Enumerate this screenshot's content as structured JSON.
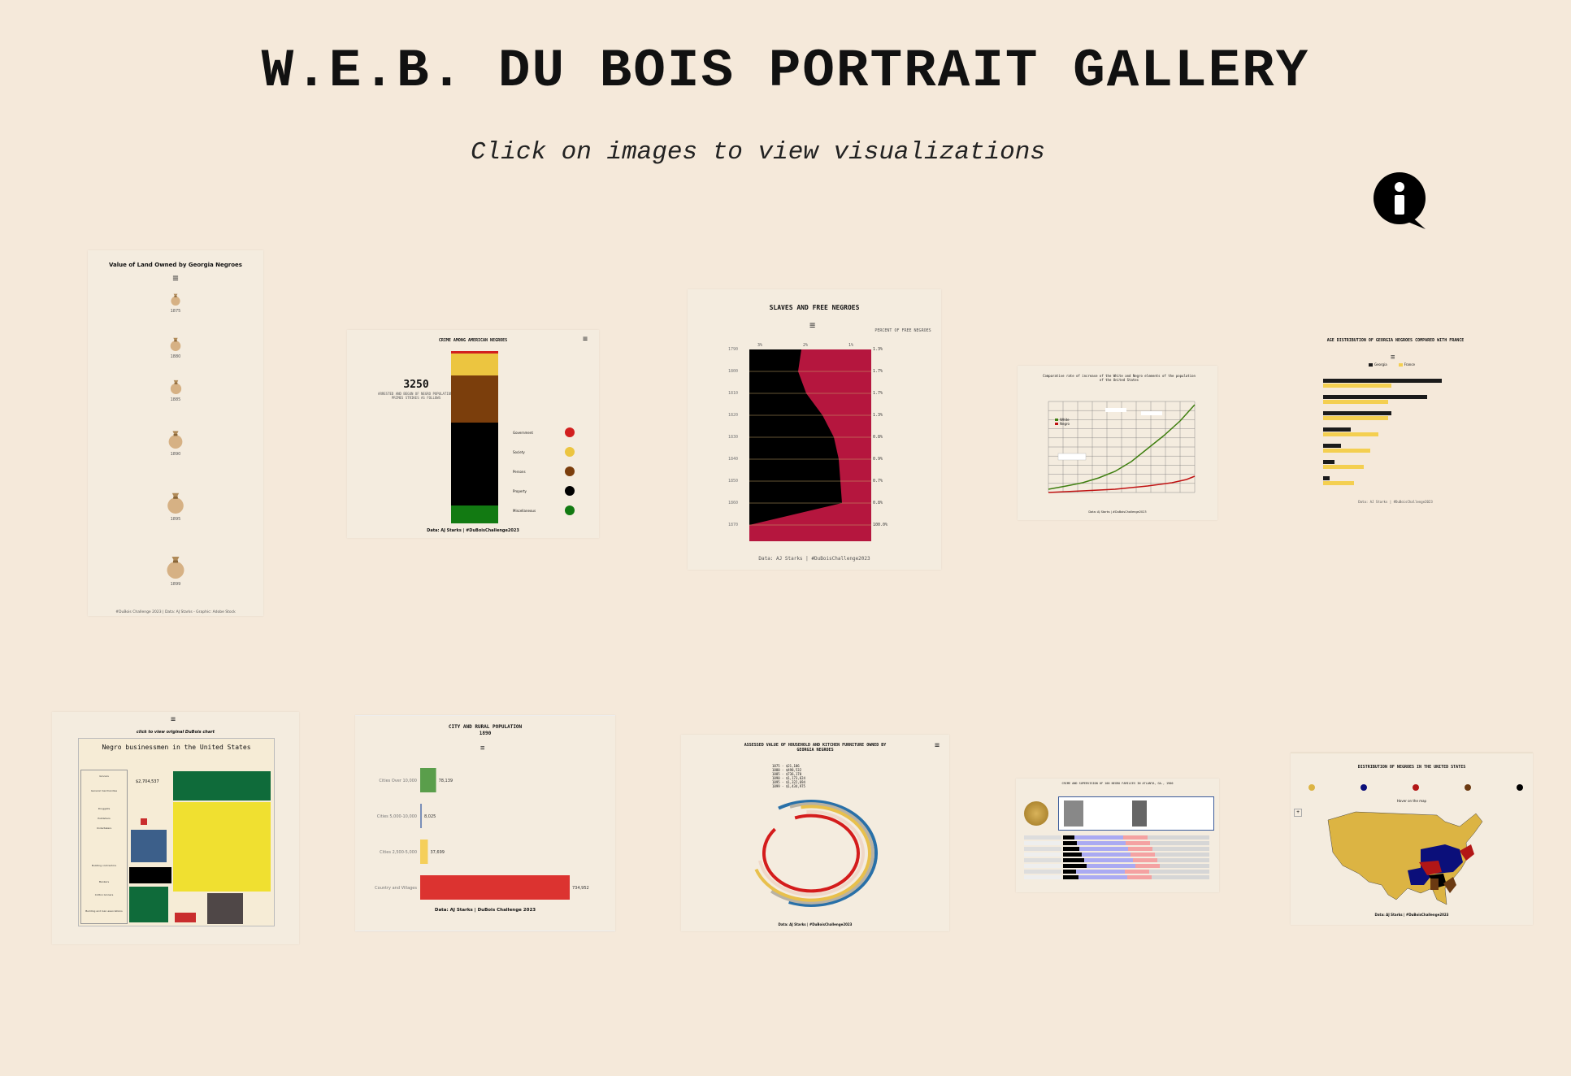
{
  "page": {
    "title": "W.E.B. DU BOIS PORTRAIT GALLERY",
    "subtitle": "Click on images to view visualizations",
    "info_icon": "info-speech-bubble-icon"
  },
  "thumbs": {
    "land": {
      "title": "Value of Land Owned by Georgia Negroes",
      "years": [
        "1875",
        "1880",
        "1885",
        "1890",
        "1895",
        "1899"
      ],
      "footer": "#DuBois Challenge 2023 | Data: AJ Starks - Graphic: Adobe Stock"
    },
    "crime": {
      "title": "CRIME AMONG AMERICAN NEGROES",
      "number": "3250",
      "desc": "ARRESTED AND BEGUN OF NEGRO POPULATION, PRIMES STRIKES AS FOLLOWS",
      "legend": [
        "Government",
        "Society",
        "Persons",
        "Property",
        "Miscellaneous"
      ],
      "footer": "Data: AJ Starks | #DuBoisChallenge2023"
    },
    "slaves": {
      "title": "SLAVES AND FREE NEGROES",
      "right_header": "PERCENT OF FREE NEGROES",
      "top_ticks": [
        "3%",
        "2%",
        "1%"
      ],
      "years": [
        "1790",
        "1800",
        "1810",
        "1820",
        "1830",
        "1840",
        "1850",
        "1860",
        "1870"
      ],
      "percents": [
        "1.3%",
        "1.7%",
        "1.7%",
        "1.3%",
        "0.8%",
        "0.9%",
        "0.7%",
        "0.8%",
        "100.0%"
      ],
      "footer": "Data: AJ Starks | #DuBoisChallenge2023"
    },
    "comparative": {
      "title": "Comparative rate of increase of the White and Negro elements of the population of the United States",
      "legend": [
        "White",
        "Negro"
      ],
      "footer": "Data: AJ Starks | #DuBoisChallenge2023"
    },
    "age": {
      "title": "AGE DISTRIBUTION OF GEORGIA NEGROES COMPARED WITH FRANCE",
      "legend": [
        "Georgia",
        "France"
      ],
      "footer": "Data: AJ Starks | #DuBoisChallenge2023"
    },
    "business": {
      "caption": "click to view original DuBois chart",
      "title": "Negro businessmen in the United States",
      "amount": "$2,704,537",
      "labels": [
        "Grocers",
        "General merchandise",
        "Druggists",
        "Publishers",
        "Undertakers",
        "Building contractors",
        "Bankers",
        "Cotton Ginners",
        "Building and loan associations"
      ]
    },
    "city": {
      "title": "CITY AND RURAL POPULATION",
      "year": "1890",
      "categories": [
        "Cities Over 10,000",
        "Cities 5,000-10,000",
        "Cities 2,500-5,000",
        "Country and Villages"
      ],
      "labels": [
        "78,139",
        "8,025",
        "37,699",
        "734,952"
      ],
      "footer": "Data: AJ Starks | DuBois Challenge 2023"
    },
    "furniture": {
      "title": "ASSESSED VALUE OF HOUSEHOLD AND KITCHEN FURNITURE OWNED BY GEORGIA NEGROES",
      "years": [
        "1875 - $21,186",
        "1880 - $498,532",
        "1885 - $736,170",
        "1890 - $1,173,624",
        "1895 - $1,322,694",
        "1899 - $1,434,975"
      ],
      "footer": "Data: AJ Starks | #DuBoisChallenge2023"
    },
    "crimeatlanta": {
      "title": "CRIME AND SUPERVISION OF 100 NEGRO FAMILIES IN ATLANTA, GA., 1900"
    },
    "distribution": {
      "title": "DISTRIBUTION OF NEGROES IN THE UNITED STATES",
      "subtitle": "Hover on the map",
      "footer": "Data: AJ Starks | #DuBoisChallenge2023"
    }
  },
  "chart_data": [
    {
      "type": "bar",
      "title": "CITY AND RURAL POPULATION",
      "subtitle": "1890",
      "categories": [
        "Cities Over 10,000",
        "Cities 5,000-10,000",
        "Cities 2,500-5,000",
        "Country and Villages"
      ],
      "values": [
        78139,
        8025,
        37699,
        734952
      ],
      "colors": [
        "#5a9e4b",
        "#7a8fb8",
        "#f5cf5a",
        "#dc3330"
      ],
      "orientation": "horizontal"
    },
    {
      "type": "bar",
      "title": "CRIME AMONG AMERICAN NEGROES",
      "stacked": true,
      "categories": [
        "Government",
        "Society",
        "Persons",
        "Property",
        "Miscellaneous"
      ],
      "colors": [
        "#d21f1f",
        "#ecc540",
        "#7b3e0c",
        "#000000",
        "#127a12"
      ]
    }
  ]
}
